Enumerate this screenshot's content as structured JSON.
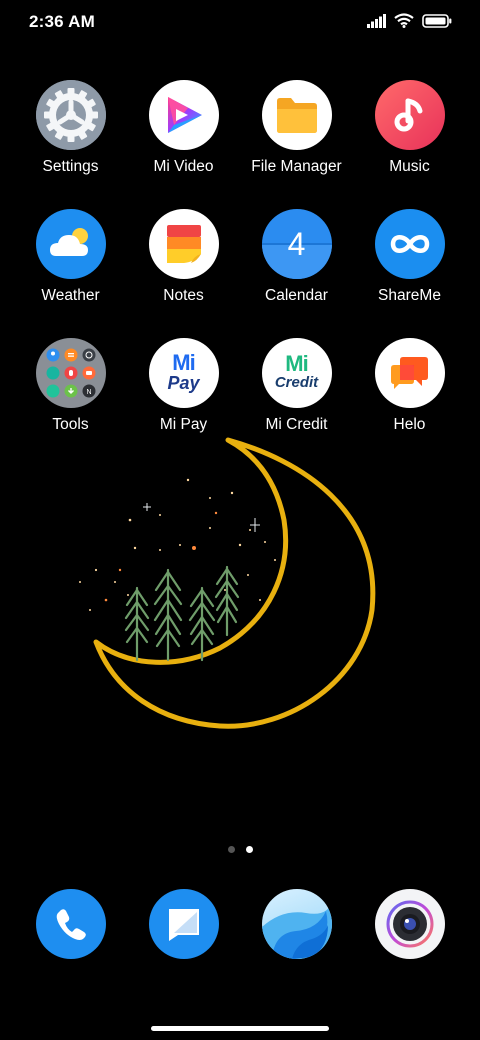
{
  "status_bar": {
    "time": "2:36 AM"
  },
  "apps": [
    {
      "label": "Settings",
      "icon": "gear-icon"
    },
    {
      "label": "Mi Video",
      "icon": "play-icon"
    },
    {
      "label": "File Manager",
      "icon": "folder-icon"
    },
    {
      "label": "Music",
      "icon": "music-note-icon"
    },
    {
      "label": "Weather",
      "icon": "cloud-sun-icon"
    },
    {
      "label": "Notes",
      "icon": "notes-icon"
    },
    {
      "label": "Calendar",
      "icon": "calendar-icon",
      "day": "4"
    },
    {
      "label": "ShareMe",
      "icon": "infinity-icon"
    },
    {
      "label": "Tools",
      "icon": "folder-grid-icon"
    },
    {
      "label": "Mi Pay",
      "icon": "mi-pay-icon",
      "logo_top": "Mi",
      "logo_bottom": "Pay"
    },
    {
      "label": "Mi Credit",
      "icon": "mi-credit-icon",
      "logo_top": "Mi",
      "logo_bottom": "Credit"
    },
    {
      "label": "Helo",
      "icon": "chat-bubbles-icon"
    }
  ],
  "dock": [
    {
      "icon": "phone-icon"
    },
    {
      "icon": "messages-icon"
    },
    {
      "icon": "browser-wave-icon"
    },
    {
      "icon": "camera-icon"
    }
  ],
  "page_indicator": {
    "pages": 2,
    "current": 2
  },
  "colors": {
    "background": "#000000",
    "moon": "#e8b00f",
    "trees": "#6f9d6a",
    "accent_blue": "#1e8ef0"
  }
}
